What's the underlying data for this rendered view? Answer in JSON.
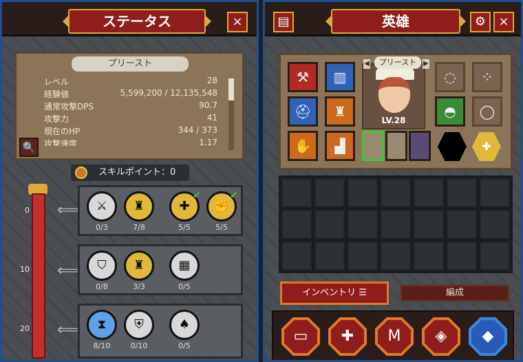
{
  "status_panel": {
    "title": "ステータス",
    "close_icon": "×",
    "class_name": "プリースト",
    "stats": [
      {
        "label": "レベル",
        "value": "28"
      },
      {
        "label": "経験値",
        "value": "5,599,200 / 12,135,548"
      },
      {
        "label": "通常攻撃DPS",
        "value": "90.7"
      },
      {
        "label": "攻撃力",
        "value": "41"
      },
      {
        "label": "現在のHP",
        "value": "344 / 373"
      },
      {
        "label": "攻撃速度",
        "value": "1.17"
      }
    ],
    "zoom_icon": "🔍",
    "skill_points_label": "スキルポイント：0",
    "tiers": [
      {
        "level": "0",
        "skills": [
          {
            "icon": "sword-crossed-icon",
            "style": "grey",
            "count": "0/3",
            "maxed": false
          },
          {
            "icon": "winged-helmet-icon",
            "style": "gold",
            "count": "7/8",
            "maxed": false
          },
          {
            "icon": "gold-hexagon-plus-icon",
            "style": "gold",
            "count": "5/5",
            "maxed": true
          },
          {
            "icon": "gold-fist-icon",
            "style": "gold",
            "count": "5/5",
            "maxed": true
          }
        ]
      },
      {
        "level": "10",
        "skills": [
          {
            "icon": "shield-icon",
            "style": "grey",
            "count": "0/8",
            "maxed": false
          },
          {
            "icon": "winged-helmet-icon",
            "style": "gold",
            "count": "3/3",
            "maxed": false
          },
          {
            "icon": "gate-icon",
            "style": "grey",
            "count": "0/5",
            "maxed": false
          }
        ]
      },
      {
        "level": "20",
        "skills": [
          {
            "icon": "hourglass-icon",
            "style": "blue",
            "count": "8/10",
            "maxed": false
          },
          {
            "icon": "shield-rune-icon",
            "style": "grey",
            "count": "0/10",
            "maxed": false
          },
          {
            "icon": "spade-icon",
            "style": "grey",
            "count": "0/5",
            "maxed": false
          }
        ]
      }
    ]
  },
  "hero_panel": {
    "title": "英雄",
    "close_icon": "×",
    "settings_icon": "gear-icon",
    "book_icon": "book-icon",
    "hero_name": "プリースト",
    "level": "LV.28",
    "inventory_tab": "インベントリ",
    "formation_tab": "編成"
  }
}
